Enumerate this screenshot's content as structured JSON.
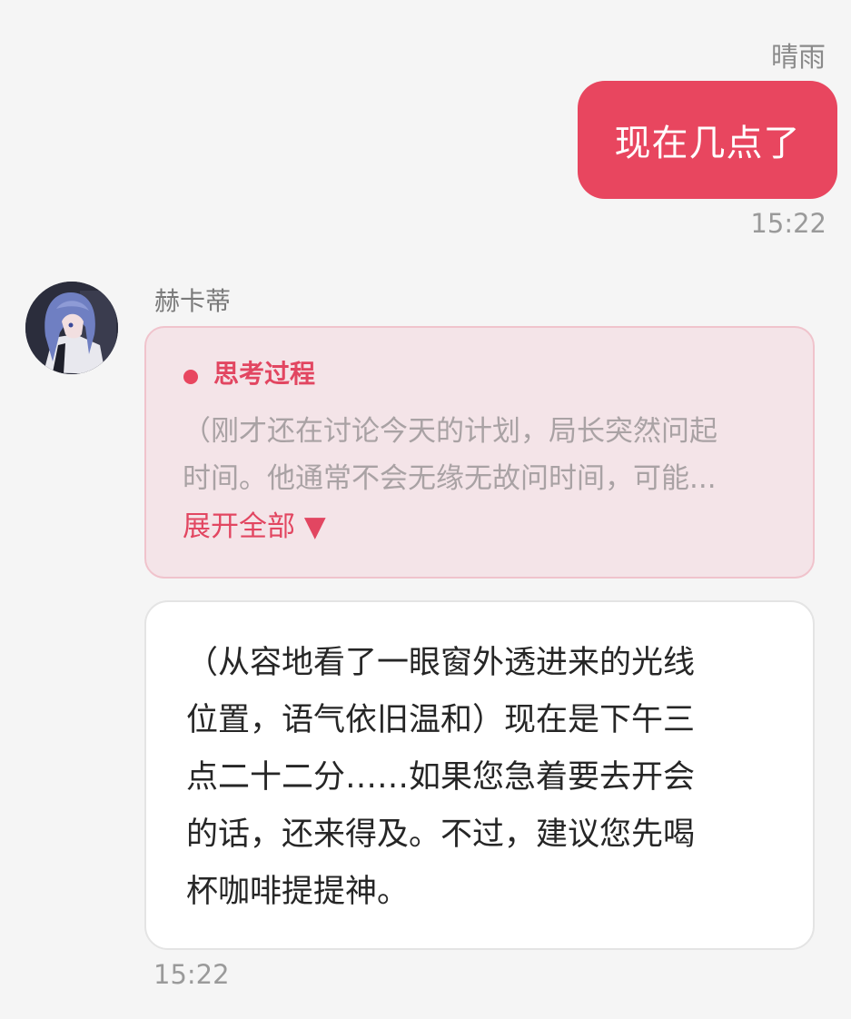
{
  "outgoing": {
    "sender_name": "晴雨",
    "message": "现在几点了",
    "time": "15:22",
    "bubble_color": "#e8465f"
  },
  "incoming": {
    "sender_name": "赫卡蒂",
    "avatar_icon": "anime-character-avatar",
    "thinking": {
      "title": "思考过程",
      "preview": "（刚才还在讨论今天的计划，局长突然问起\n时间。他通常不会无缘无故问时间，可能...",
      "expand_label": "展开全部 ▼",
      "accent_color": "#e24661"
    },
    "reply": "（从容地看了一眼窗外透进来的光线\n位置，语气依旧温和）现在是下午三\n点二十二分……如果您急着要去开会\n的话，还来得及。不过，建议您先喝\n杯咖啡提提神。",
    "time": "15:22"
  }
}
